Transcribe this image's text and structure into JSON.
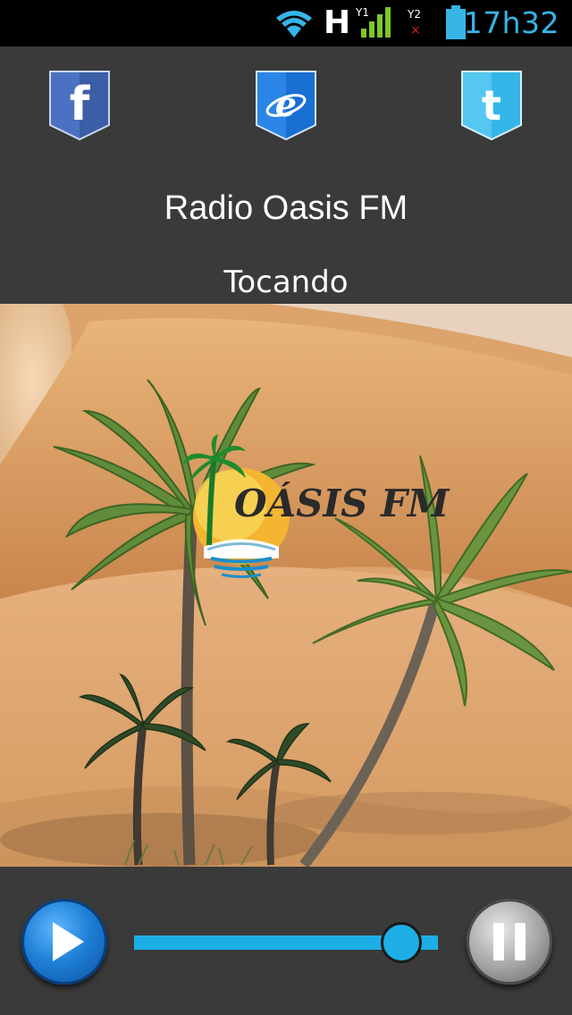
{
  "status_bar": {
    "network_type": "H",
    "time": "17h32",
    "icons": [
      "wifi-icon",
      "signal-sim1-icon",
      "signal-sim2-icon",
      "battery-icon"
    ]
  },
  "social": {
    "facebook_icon": "facebook-icon",
    "browser_icon": "internet-explorer-icon",
    "twitter_icon": "twitter-icon"
  },
  "station": {
    "title": "Radio Oasis FM",
    "status": "Tocando"
  },
  "artwork": {
    "logo_text": "OÁSIS FM"
  },
  "player": {
    "play_icon": "play-icon",
    "pause_icon": "pause-icon",
    "volume_level": 0.88
  },
  "colors": {
    "accent": "#1daee6",
    "status_time": "#36b5e6",
    "background": "#3a3a3a"
  }
}
